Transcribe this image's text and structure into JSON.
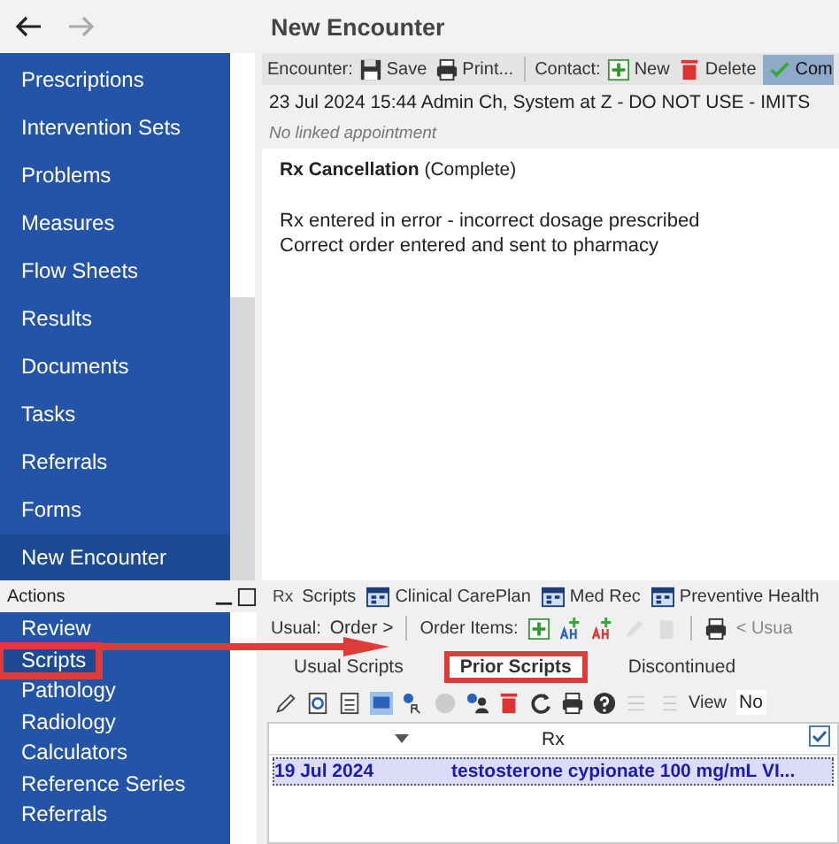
{
  "page_title": "New Encounter",
  "sidebar": {
    "items": [
      {
        "label": "Prescriptions",
        "selected": false
      },
      {
        "label": "Intervention Sets",
        "selected": false
      },
      {
        "label": "Problems",
        "selected": false
      },
      {
        "label": "Measures",
        "selected": false
      },
      {
        "label": "Flow Sheets",
        "selected": false
      },
      {
        "label": "Results",
        "selected": false
      },
      {
        "label": "Documents",
        "selected": false
      },
      {
        "label": "Tasks",
        "selected": false
      },
      {
        "label": "Referrals",
        "selected": false
      },
      {
        "label": "Forms",
        "selected": false
      },
      {
        "label": "New Encounter",
        "selected": true
      }
    ]
  },
  "encounter_toolbar": {
    "label": "Encounter:",
    "contact_label": "Contact:",
    "buttons": [
      {
        "kind": "save",
        "label": "Save"
      },
      {
        "kind": "print",
        "label": "Print..."
      },
      {
        "kind": "new",
        "label": "New"
      },
      {
        "kind": "delete",
        "label": "Delete"
      },
      {
        "kind": "complete",
        "label": "Com"
      }
    ]
  },
  "encounter": {
    "header": "23 Jul 2024 15:44 Admin Ch, System at Z - DO NOT USE - IMITS",
    "appointment": "No linked appointment",
    "note_title": "Rx Cancellation",
    "note_status": "(Complete)",
    "note_lines": [
      "Rx entered in error - incorrect dosage prescribed",
      "Correct order entered and sent to pharmacy"
    ]
  },
  "actions": {
    "title": "Actions",
    "items": [
      {
        "label": "Review",
        "selected": false,
        "callout": false
      },
      {
        "label": "Scripts",
        "selected": true,
        "callout": true
      },
      {
        "label": "Pathology",
        "selected": false,
        "callout": false
      },
      {
        "label": "Radiology",
        "selected": false,
        "callout": false
      },
      {
        "label": "Calculators",
        "selected": false,
        "callout": false
      },
      {
        "label": "Reference Series",
        "selected": false,
        "callout": false
      },
      {
        "label": "Referrals",
        "selected": false,
        "callout": false
      }
    ]
  },
  "tabs": [
    {
      "kind": "rx",
      "icon": "Rx",
      "label": "Scripts"
    },
    {
      "kind": "plan",
      "label": "Clinical CarePlan"
    },
    {
      "kind": "plan",
      "label": "Med Rec"
    },
    {
      "kind": "plan",
      "label": "Preventive Health"
    }
  ],
  "usual_bar": {
    "usual_label": "Usual:",
    "order_button": "Order >",
    "order_items_label": "Order Items:",
    "usual_dropdown": "< Usua"
  },
  "sub_tabs": [
    {
      "label": "Usual Scripts",
      "selected": false,
      "callout": false
    },
    {
      "label": "Prior Scripts",
      "selected": true,
      "callout": true
    },
    {
      "label": "Discontinued",
      "selected": false,
      "callout": false
    }
  ],
  "scripts_toolbar": {
    "view_label": "View",
    "view_value": "No"
  },
  "table": {
    "columns": [
      "Rx"
    ],
    "rows": [
      {
        "date": "19 Jul 2024",
        "rx": "testosterone cypionate 100 mg/mL VI...",
        "selected": true
      }
    ]
  }
}
